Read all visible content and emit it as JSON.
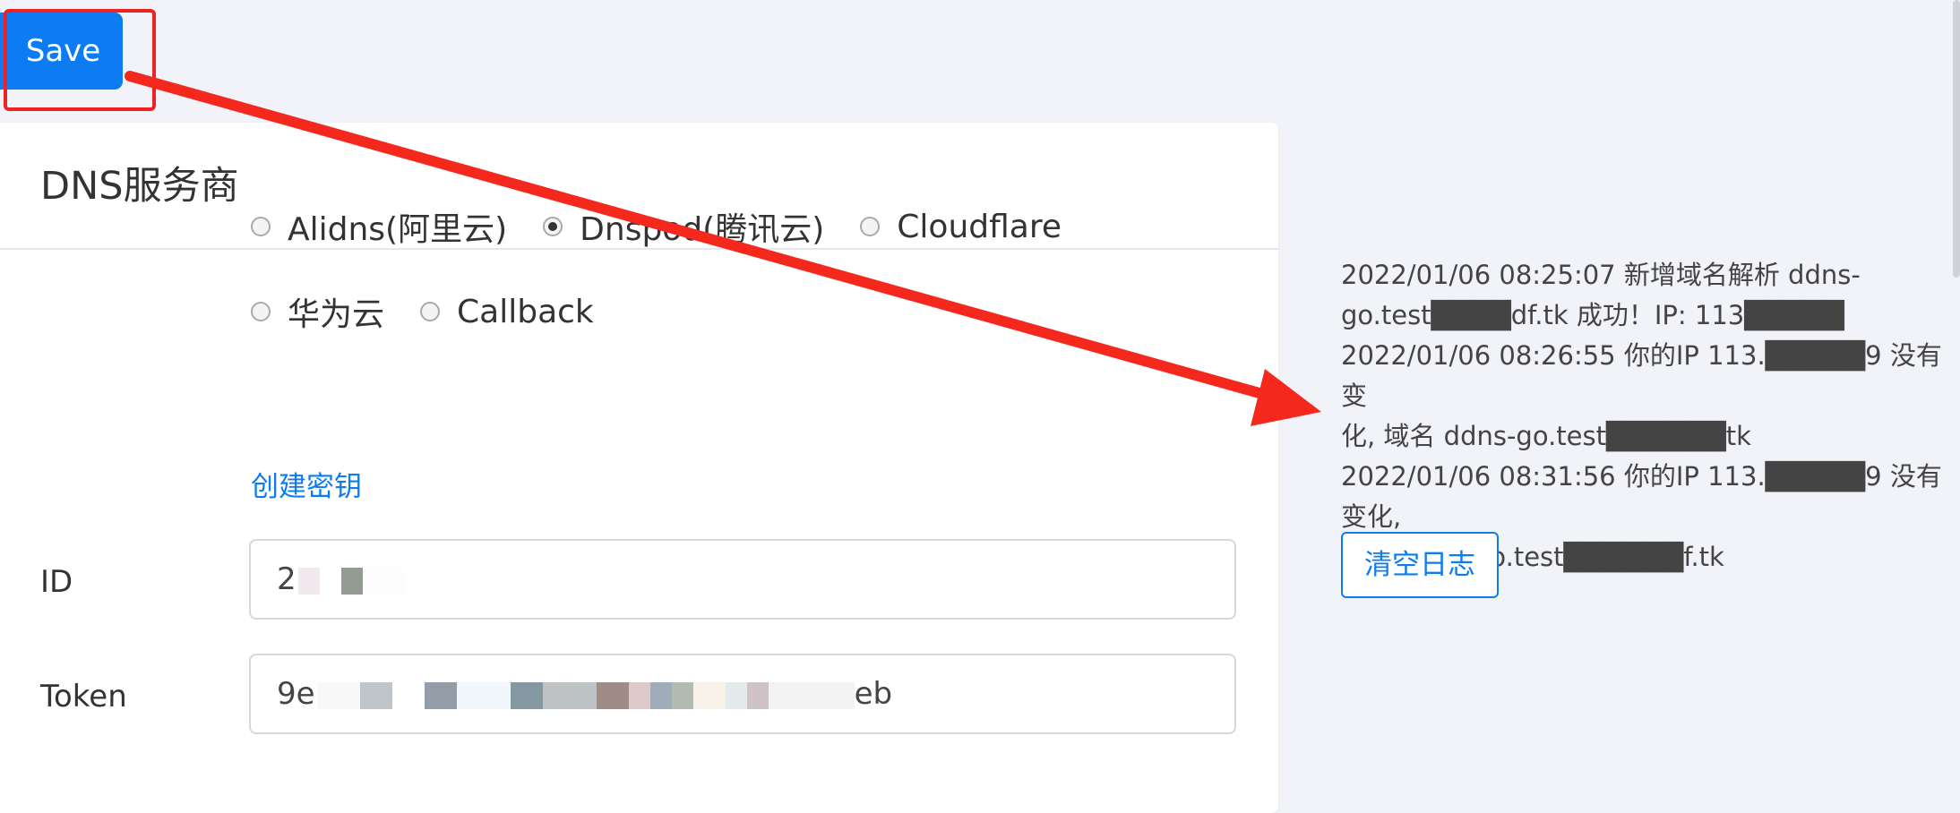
{
  "toolbar": {
    "save_label": "Save"
  },
  "card": {
    "title": "DNS服务商",
    "providers": [
      {
        "label": "Alidns(阿里云)",
        "checked": false
      },
      {
        "label": "Dnspod(腾讯云)",
        "checked": true
      },
      {
        "label": "Cloudflare",
        "checked": false
      },
      {
        "label": "华为云",
        "checked": false
      },
      {
        "label": "Callback",
        "checked": false
      }
    ],
    "create_key_link": "创建密钥",
    "id_label": "ID",
    "id_value": "2",
    "token_label": "Token",
    "token_value": "9e",
    "token_suffix": "eb"
  },
  "logs": {
    "lines": [
      "2022/01/06 08:25:07 新增域名解析 ddns-",
      "go.test████df.tk 成功！IP: 113█████",
      "2022/01/06 08:26:55 你的IP 113.█████9 没有变",
      "化, 域名 ddns-go.test██████tk",
      "2022/01/06 08:31:56 你的IP 113.█████9 没有变化,",
      "域名 ddns-go.test██████f.tk"
    ],
    "clear_label": "清空日志"
  },
  "colors": {
    "accent": "#0d7cf2",
    "highlight": "#ee2222",
    "background": "#f1f3f8"
  }
}
